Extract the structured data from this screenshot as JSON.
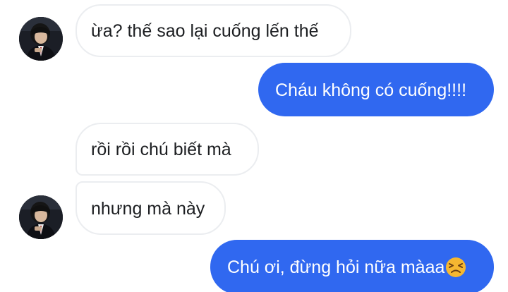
{
  "conversation": {
    "messages": [
      {
        "sender": "other",
        "text": "ừa? thế sao lại cuống lến thế"
      },
      {
        "sender": "me",
        "text": "Cháu không có cuống!!!!"
      },
      {
        "sender": "other",
        "text": "rồi rồi chú biết mà"
      },
      {
        "sender": "other",
        "text": "nhưng mà này"
      },
      {
        "sender": "me",
        "text": "Chú ơi, đừng hỏi nữa màaa",
        "emoji": "persevering-face-emoji"
      }
    ]
  },
  "colors": {
    "outgoing_bubble": "#3068f0",
    "outgoing_text": "#ffffff",
    "incoming_bubble": "#ffffff",
    "incoming_border": "#ebedf0",
    "incoming_text": "#1c1e21",
    "emoji_face": "#f5b731"
  }
}
